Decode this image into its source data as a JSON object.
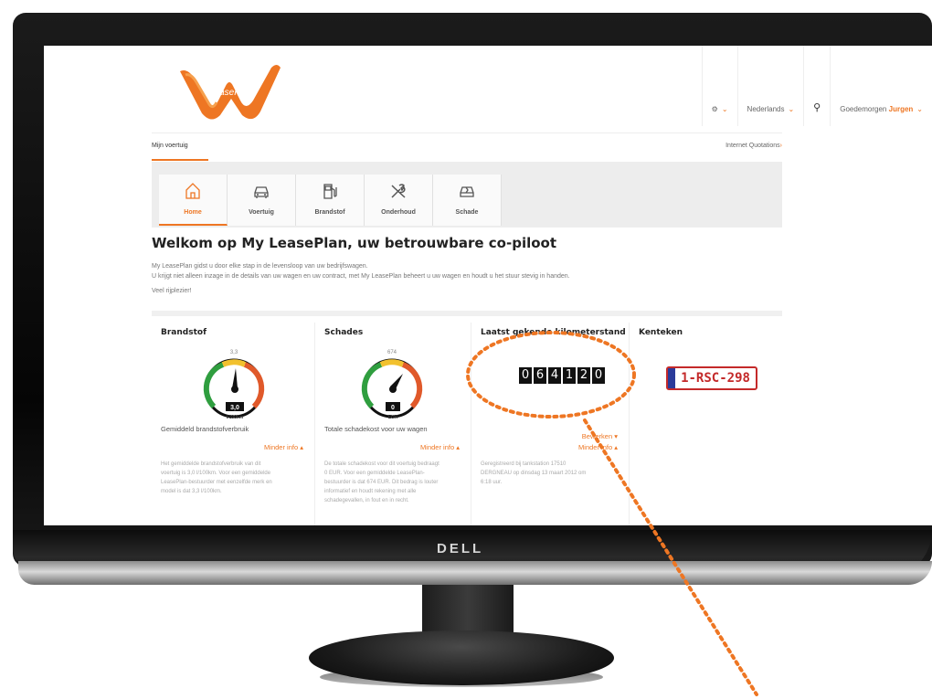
{
  "monitor": {
    "brand": "DELL",
    "power_glyph": "⏻"
  },
  "header": {
    "logo_text": "LeasePlan",
    "settings_icon": "gear-icon",
    "language": "Nederlands",
    "search_icon": "search-icon",
    "greeting": "Goedemorgen",
    "user": "Jurgen"
  },
  "subnav": {
    "active": "Mijn voertuig",
    "right": "Internet Quotations"
  },
  "tabs": [
    {
      "label": "Home",
      "icon": "home-icon"
    },
    {
      "label": "Voertuig",
      "icon": "car-icon"
    },
    {
      "label": "Brandstof",
      "icon": "fuel-icon"
    },
    {
      "label": "Onderhoud",
      "icon": "tools-icon"
    },
    {
      "label": "Schade",
      "icon": "damaged-car-icon"
    }
  ],
  "welcome": {
    "title": "Welkom op My LeasePlan, uw betrouwbare co-piloot",
    "line1": "My LeasePlan gidst u door elke stap in de levensloop van uw bedrijfswagen.",
    "line2": "U krijgt niet alleen inzage in de details van uw wagen en uw contract, met My LeasePlan beheert u uw wagen en houdt u het stuur stevig in handen.",
    "line3": "Veel rijplezier!"
  },
  "cards": {
    "brandstof": {
      "title": "Brandstof",
      "gauge_top": "3,3",
      "gauge_value": "3,0",
      "gauge_unit": "l/100km",
      "caption": "Gemiddeld brandstofverbruik",
      "less_info": "Minder info",
      "details": [
        "Het gemiddelde brandstofverbruik van dit",
        "voertuig is 3,0 l/100km. Voor een gemiddelde",
        "LeasePlan-bestuurder met eenzelfde merk en",
        "model is dat 3,3 l/100km."
      ]
    },
    "schades": {
      "title": "Schades",
      "gauge_top": "674",
      "gauge_value": "0",
      "gauge_unit": "EUR",
      "caption": "Totale schadekost voor uw wagen",
      "less_info": "Minder info",
      "details": [
        "De totale schadekost voor dit voertuig bedraagt",
        "0 EUR. Voor een gemiddelde LeasePlan-",
        "bestuurder is dat 674 EUR. Dit bedrag is louter",
        "informatief en houdt rekening met alle",
        "schadegevallen, in fout en in recht."
      ]
    },
    "kilometer": {
      "title": "Laatst gekende kilometerstand",
      "digits": [
        "0",
        "6",
        "4",
        "1",
        "2",
        "0"
      ],
      "edit": "Bewerken",
      "less_info": "Minder info",
      "details": [
        "Geregistreerd bij tankstation 17510",
        "DERGNEAU op dinsdag 13 maart 2012 om",
        "6:18 uur."
      ]
    },
    "kenteken": {
      "title": "Kenteken",
      "plate": "1-RSC-298"
    }
  },
  "colors": {
    "accent": "#ee7623",
    "plate_red": "#c42a2a",
    "eu_blue": "#2a3b9a"
  }
}
